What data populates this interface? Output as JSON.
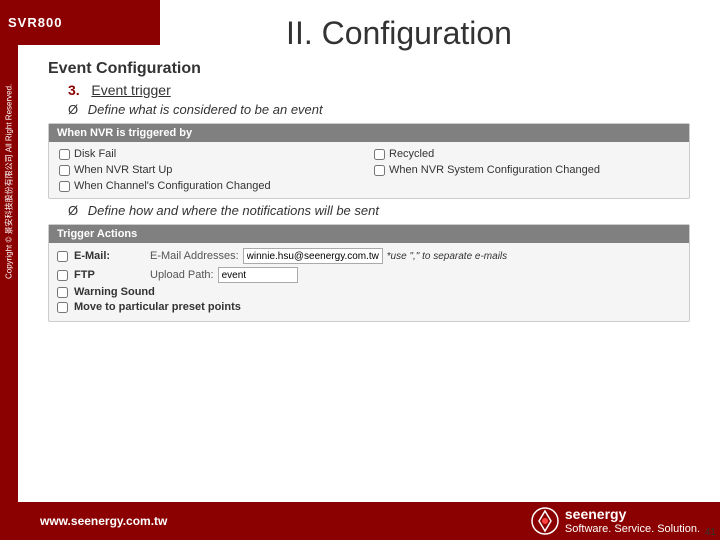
{
  "sidebar": {
    "brand": "SVR800",
    "vertical_text": "Copyright © 景安科技股份有限公司 All Right Reserved."
  },
  "header": {
    "title": "II.   Configuration"
  },
  "section": {
    "heading": "Event Configuration",
    "step_number": "3.",
    "step_label": "Event trigger"
  },
  "bullet1": {
    "arrow": "Ø",
    "text": "Define what is considered to be an event"
  },
  "bullet2": {
    "arrow": "Ø",
    "text": "Define how and where the notifications will be sent"
  },
  "trigger_box": {
    "header": "When NVR is triggered by",
    "checkboxes": [
      {
        "label": "Disk Fail",
        "checked": false
      },
      {
        "label": "Recycled",
        "checked": false
      },
      {
        "label": "When NVR Start Up",
        "checked": false
      },
      {
        "label": "When NVR System Configuration Changed",
        "checked": false
      },
      {
        "label": "When Channel's Configuration Changed",
        "checked": false
      }
    ]
  },
  "actions_box": {
    "header": "Trigger Actions",
    "rows": [
      {
        "checked": false,
        "label": "E-Mail:",
        "field_label": "E-Mail Addresses:",
        "value": "winnie.hsu@seenergy.com.tw",
        "note": "*use \",\" to separate e-mails"
      },
      {
        "checked": false,
        "label": "FTP",
        "field_label": "Upload Path:",
        "value": "event",
        "note": ""
      },
      {
        "checked": false,
        "label": "Warning Sound",
        "field_label": "",
        "value": "",
        "note": ""
      },
      {
        "checked": false,
        "label": "Move to particular preset points",
        "field_label": "",
        "value": "",
        "note": ""
      }
    ]
  },
  "footer": {
    "url": "www.seenergy.com.tw",
    "brand": "seenergy",
    "tagline": "Software. Service. Solution.",
    "page_number": "41"
  }
}
